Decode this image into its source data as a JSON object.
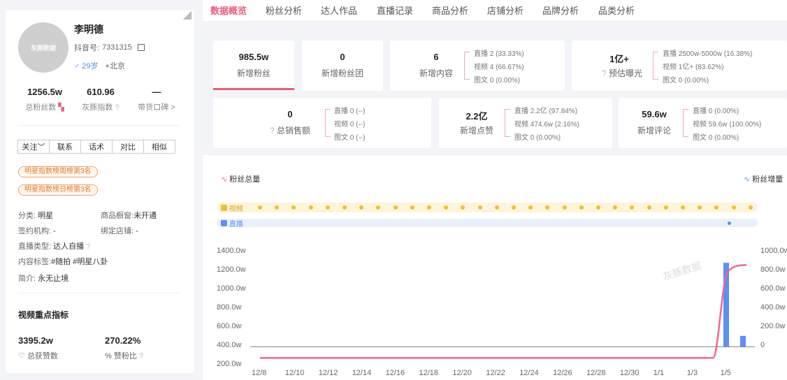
{
  "profile": {
    "name": "李明德",
    "douyin_id_label": "抖音号:",
    "douyin_id": "7331315",
    "gender": "♂ 29岁",
    "location": "北京",
    "avatar_text": "灰豚数据"
  },
  "stats": [
    {
      "value": "1256.5w",
      "label": "总粉丝数"
    },
    {
      "value": "610.96",
      "label": "灰豚指数"
    },
    {
      "value": "—",
      "label": "带货口碑 >"
    }
  ],
  "actions": [
    "关注﹀",
    "联系",
    "话术",
    "对比",
    "相似"
  ],
  "tags": [
    "明星指数榜周榜第3名",
    "明星指数榜日榜第3名"
  ],
  "info": {
    "category_label": "分类:",
    "category": "明星",
    "shop_label": "商品橱窗:",
    "shop": "未开通",
    "agency_label": "签约机构:",
    "agency": "-",
    "store_label": "绑定店铺:",
    "store": "-",
    "live_type_label": "直播类型:",
    "live_type": "达人自播",
    "content_tags_label": "内容标签:",
    "content_tags": "#随拍  #明星八卦",
    "intro_label": "简介:",
    "intro": "永无止境"
  },
  "video_section": {
    "title": "视频重点指标",
    "likes_value": "3395.2w",
    "likes_label": "总获赞数",
    "ratio_value": "270.22%",
    "ratio_label": "赞粉比"
  },
  "tabs": [
    "数据概览",
    "粉丝分析",
    "达人作品",
    "直播记录",
    "商品分析",
    "店铺分析",
    "品牌分析",
    "品类分析"
  ],
  "cards": {
    "fans": {
      "value": "985.5w",
      "label": "新增粉丝"
    },
    "fan_group": {
      "value": "0",
      "label": "新增粉丝团"
    },
    "content": {
      "value": "6",
      "label": "新增内容",
      "rows": [
        "直播  2  (33.33%)",
        "视频  4  (66.67%)",
        "图文  0  (0.00%)"
      ]
    },
    "exposure": {
      "value": "1亿+",
      "label": "预估曝光",
      "rows": [
        "直播  2500w-5000w  (16.38%)",
        "视频  1亿+  (83.62%)",
        "图文  0  (0.00%)"
      ]
    },
    "sales": {
      "value": "0",
      "label": "总销售额",
      "rows": [
        "直播  0  (--)",
        "视频  0  (--)",
        "图文  0  (--)"
      ]
    },
    "likes": {
      "value": "2.2亿",
      "label": "新增点赞",
      "rows": [
        "直播  2.2亿  (97.84%)",
        "视频  474.6w  (2.16%)",
        "图文  0  (0.00%)"
      ]
    },
    "comments": {
      "value": "59.6w",
      "label": "新增评论",
      "rows": [
        "直播  0  (0.00%)",
        "视频  59.6w  (100.00%)",
        "图文  0  (0.00%)"
      ]
    }
  },
  "legend": {
    "left": "粉丝总量",
    "right": "粉丝增量",
    "video": "视频",
    "live": "直播"
  },
  "watermark": "灰豚数据",
  "chart_data": {
    "type": "line",
    "x": [
      "12/8",
      "12/10",
      "12/12",
      "12/14",
      "12/16",
      "12/18",
      "12/20",
      "12/22",
      "12/24",
      "12/26",
      "12/28",
      "12/30",
      "1/1",
      "1/3",
      "1/5"
    ],
    "left_axis_ticks": [
      "1400.0w",
      "1200.0w",
      "1000.0w",
      "800.0w",
      "600.0w",
      "400.0w",
      "200.0w"
    ],
    "right_axis_ticks": [
      "1000.0w",
      "800.0w",
      "600.0w",
      "400.0w",
      "200.0w",
      "0"
    ],
    "series": [
      {
        "name": "粉丝总量",
        "values": [
          271,
          271,
          271,
          271,
          271,
          271,
          271,
          271,
          271,
          271,
          271,
          271,
          271,
          1200,
          1256
        ]
      },
      {
        "name": "粉丝增量",
        "type": "bar",
        "values": [
          0,
          0,
          0,
          0,
          0,
          0,
          0,
          0,
          0,
          0,
          0,
          0,
          0,
          880,
          105
        ]
      }
    ],
    "colors": {
      "total": "#f06a8c",
      "increment": "#5b8ff9",
      "video": "#f2c02e"
    }
  }
}
